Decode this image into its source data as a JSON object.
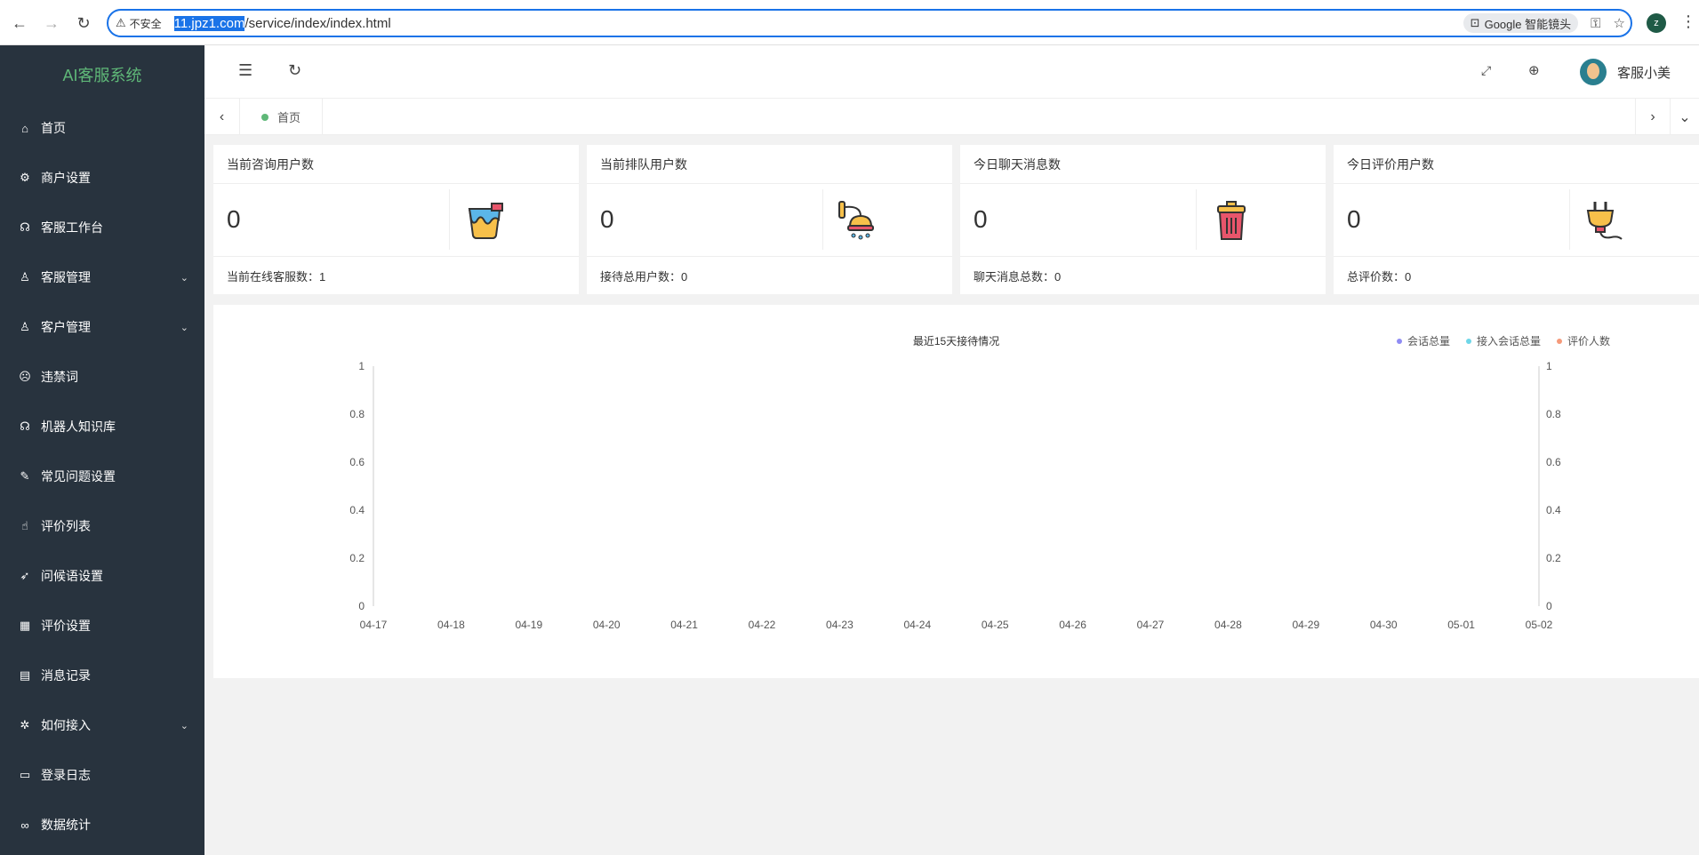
{
  "browser": {
    "security_warning": "不安全",
    "url_highlight": "11.jpz1.com",
    "url_rest": "/service/index/index.html",
    "lens_label": "Google 智能镜头",
    "profile_initial": "z"
  },
  "sidebar": {
    "logo": "AI客服系统",
    "items": [
      {
        "label": "首页",
        "icon": "home-icon",
        "glyph": "⌂",
        "chevron": false
      },
      {
        "label": "商户设置",
        "icon": "gear-icon",
        "glyph": "⚙",
        "chevron": false
      },
      {
        "label": "客服工作台",
        "icon": "headset-icon",
        "glyph": "☊",
        "chevron": false
      },
      {
        "label": "客服管理",
        "icon": "user-icon",
        "glyph": "♙",
        "chevron": true
      },
      {
        "label": "客户管理",
        "icon": "user-group-icon",
        "glyph": "♙",
        "chevron": true
      },
      {
        "label": "违禁词",
        "icon": "face-icon",
        "glyph": "☹",
        "chevron": false
      },
      {
        "label": "机器人知识库",
        "icon": "headset-icon",
        "glyph": "☊",
        "chevron": false
      },
      {
        "label": "常见问题设置",
        "icon": "edit-icon",
        "glyph": "✎",
        "chevron": false
      },
      {
        "label": "评价列表",
        "icon": "thumb-icon",
        "glyph": "☝",
        "chevron": false
      },
      {
        "label": "问候语设置",
        "icon": "send-icon",
        "glyph": "➶",
        "chevron": false
      },
      {
        "label": "评价设置",
        "icon": "calendar-icon",
        "glyph": "▦",
        "chevron": false
      },
      {
        "label": "消息记录",
        "icon": "note-icon",
        "glyph": "▤",
        "chevron": false
      },
      {
        "label": "如何接入",
        "icon": "bug-icon",
        "glyph": "✲",
        "chevron": true
      },
      {
        "label": "登录日志",
        "icon": "table-icon",
        "glyph": "▭",
        "chevron": false
      },
      {
        "label": "数据统计",
        "icon": "link-icon",
        "glyph": "∞",
        "chevron": false
      }
    ]
  },
  "header": {
    "user_name": "客服小美"
  },
  "tabs": [
    {
      "label": "首页"
    }
  ],
  "cards": [
    {
      "title": "当前咨询用户数",
      "value": "0",
      "footer": "当前在线客服数：1",
      "icon": "paint-bucket-icon"
    },
    {
      "title": "当前排队用户数",
      "value": "0",
      "footer": "接待总用户数：0",
      "icon": "shower-icon"
    },
    {
      "title": "今日聊天消息数",
      "value": "0",
      "footer": "聊天消息总数：0",
      "icon": "trash-can-icon"
    },
    {
      "title": "今日评价用户数",
      "value": "0",
      "footer": "总评价数：0",
      "icon": "plug-icon"
    }
  ],
  "chart_data": {
    "type": "line",
    "title": "最近15天接待情况",
    "categories": [
      "04-17",
      "04-18",
      "04-19",
      "04-20",
      "04-21",
      "04-22",
      "04-23",
      "04-24",
      "04-25",
      "04-26",
      "04-27",
      "04-28",
      "04-29",
      "04-30",
      "05-01",
      "05-02"
    ],
    "series": [
      {
        "name": "会话总量",
        "color": "#8f8cf4",
        "values": [
          0,
          0,
          0,
          0,
          0,
          0,
          0,
          0,
          0,
          0,
          0,
          0,
          0,
          0,
          0,
          0
        ]
      },
      {
        "name": "接入会话总量",
        "color": "#6fd6e8",
        "values": [
          0,
          0,
          0,
          0,
          0,
          0,
          0,
          0,
          0,
          0,
          0,
          0,
          0,
          0,
          0,
          0
        ]
      },
      {
        "name": "评价人数",
        "color": "#f59a7a",
        "values": [
          0,
          0,
          0,
          0,
          0,
          0,
          0,
          0,
          0,
          0,
          0,
          0,
          0,
          0,
          0,
          0
        ]
      }
    ],
    "ylim": [
      0,
      1
    ],
    "yticks": [
      "0",
      "0.2",
      "0.4",
      "0.6",
      "0.8",
      "1"
    ],
    "legend": "top-right",
    "dual_axis": true
  }
}
